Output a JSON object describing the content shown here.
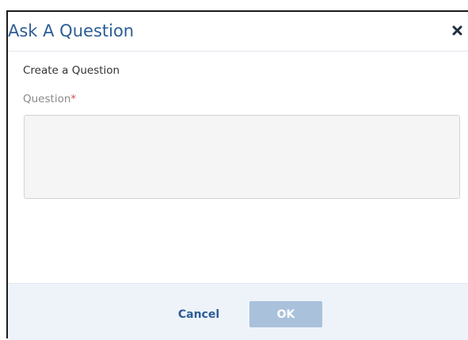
{
  "dialog": {
    "title": "Ask A Question",
    "close_icon": "close-icon",
    "section_label": "Create a Question",
    "field": {
      "label": "Question",
      "required_marker": "*",
      "value": "",
      "placeholder": ""
    },
    "buttons": {
      "cancel": "Cancel",
      "ok": "OK",
      "ok_enabled": false
    }
  },
  "colors": {
    "title": "#2c5d95",
    "required": "#d9534f",
    "footer_bg": "#eef3f9",
    "ok_disabled_bg": "#a9c1da",
    "textarea_bg": "#f5f5f5"
  }
}
